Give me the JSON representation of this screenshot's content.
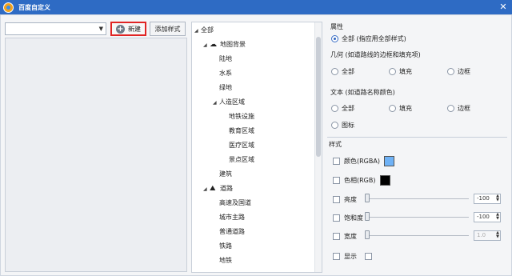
{
  "window": {
    "title": "百度自定义",
    "close": "✕"
  },
  "toolbar": {
    "combo_value": "",
    "new_label": "新建",
    "add_style_label": "添加样式"
  },
  "tree": [
    {
      "label": "全部",
      "indent": 0,
      "expand": "◢",
      "icon": ""
    },
    {
      "label": "地图背景",
      "indent": 1,
      "expand": "◢",
      "icon": "cloud"
    },
    {
      "label": "陆地",
      "indent": 2,
      "expand": "",
      "icon": ""
    },
    {
      "label": "水系",
      "indent": 2,
      "expand": "",
      "icon": ""
    },
    {
      "label": "绿地",
      "indent": 2,
      "expand": "",
      "icon": ""
    },
    {
      "label": "人造区域",
      "indent": 2,
      "expand": "◢",
      "icon": ""
    },
    {
      "label": "地铁设施",
      "indent": 3,
      "expand": "",
      "icon": ""
    },
    {
      "label": "教育区域",
      "indent": 3,
      "expand": "",
      "icon": ""
    },
    {
      "label": "医疗区域",
      "indent": 3,
      "expand": "",
      "icon": ""
    },
    {
      "label": "景点区域",
      "indent": 3,
      "expand": "",
      "icon": ""
    },
    {
      "label": "建筑",
      "indent": 2,
      "expand": "",
      "icon": ""
    },
    {
      "label": "道路",
      "indent": 1,
      "expand": "◢",
      "icon": "road"
    },
    {
      "label": "高速及国道",
      "indent": 2,
      "expand": "",
      "icon": ""
    },
    {
      "label": "城市主路",
      "indent": 2,
      "expand": "",
      "icon": ""
    },
    {
      "label": "普通道路",
      "indent": 2,
      "expand": "",
      "icon": ""
    },
    {
      "label": "铁路",
      "indent": 2,
      "expand": "",
      "icon": ""
    },
    {
      "label": "地铁",
      "indent": 2,
      "expand": "",
      "icon": ""
    }
  ],
  "props": {
    "section_label": "属性",
    "all_option": "全部 (指应用全部样式)",
    "geometry_label": "几何 (如道路线的边框和填充项)",
    "geometry_options": [
      "全部",
      "填充",
      "边框"
    ],
    "text_label": "文本 (如道路名称颜色)",
    "text_options": [
      "全部",
      "填充",
      "边框"
    ],
    "icon_option": "图标"
  },
  "style": {
    "section_label": "样式",
    "color_label": "颜色(RGBA)",
    "color_value": "#6fb2f6",
    "hue_label": "色相(RGB)",
    "hue_value": "#000000",
    "brightness_label": "亮度",
    "brightness_value": "-100",
    "saturation_label": "饱和度",
    "saturation_value": "-100",
    "width_label": "宽度",
    "width_value": "1.0",
    "visible_label": "显示"
  }
}
